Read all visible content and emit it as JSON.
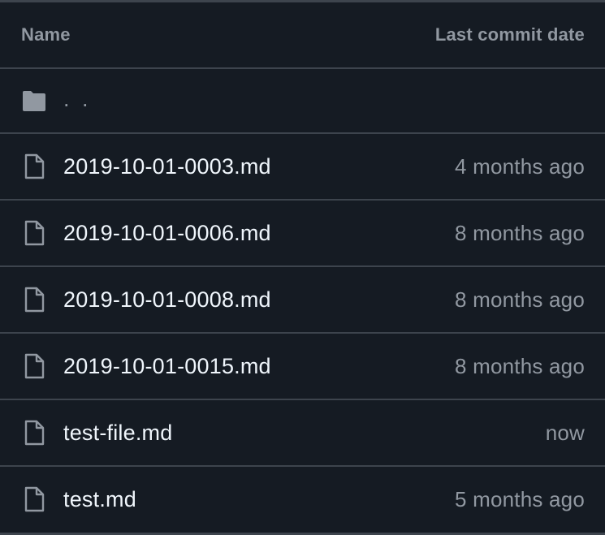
{
  "header": {
    "name_label": "Name",
    "date_label": "Last commit date"
  },
  "parent": {
    "label": ". .",
    "icon": "folder-icon"
  },
  "files": [
    {
      "name": "2019-10-01-0003.md",
      "date": "4 months ago",
      "icon": "file-icon"
    },
    {
      "name": "2019-10-01-0006.md",
      "date": "8 months ago",
      "icon": "file-icon"
    },
    {
      "name": "2019-10-01-0008.md",
      "date": "8 months ago",
      "icon": "file-icon"
    },
    {
      "name": "2019-10-01-0015.md",
      "date": "8 months ago",
      "icon": "file-icon"
    },
    {
      "name": "test-file.md",
      "date": "now",
      "icon": "file-icon"
    },
    {
      "name": "test.md",
      "date": "5 months ago",
      "icon": "file-icon"
    }
  ],
  "colors": {
    "background": "#151b23",
    "border": "#3d444d",
    "text_primary": "#f0f6fc",
    "text_muted": "#9198a1"
  }
}
